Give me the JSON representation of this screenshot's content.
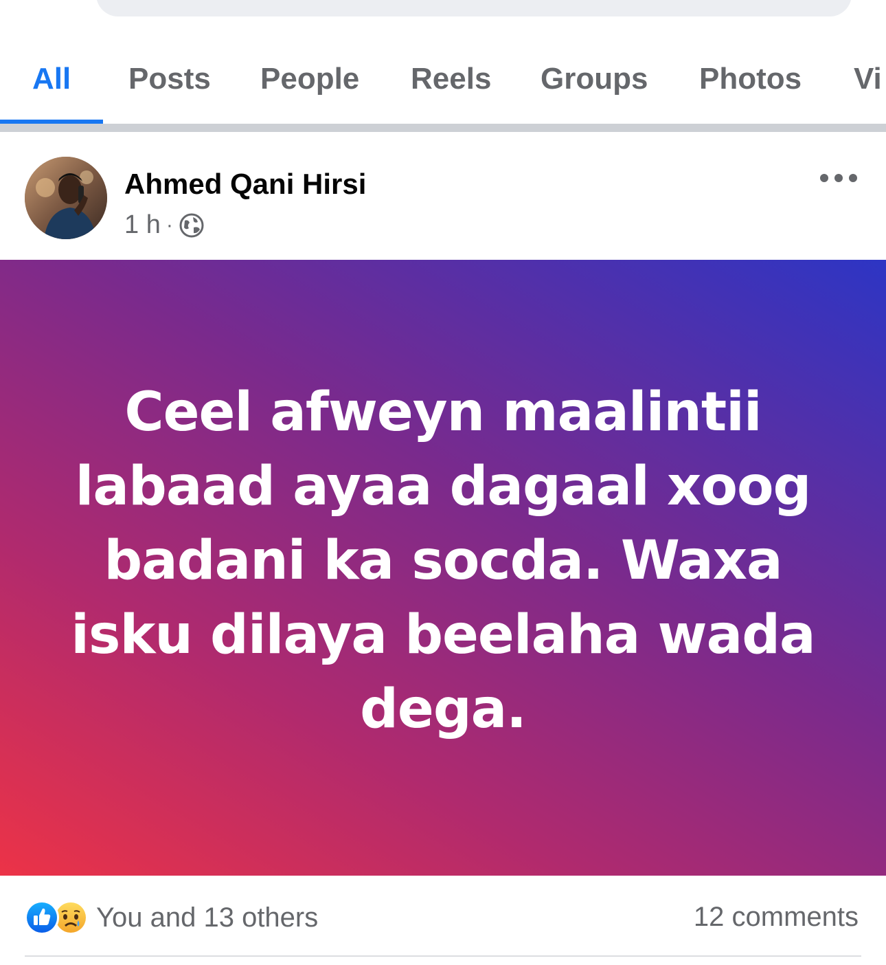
{
  "tabs": [
    {
      "label": "All",
      "active": true
    },
    {
      "label": "Posts"
    },
    {
      "label": "People"
    },
    {
      "label": "Reels"
    },
    {
      "label": "Groups"
    },
    {
      "label": "Photos"
    },
    {
      "label": "Vi"
    }
  ],
  "post": {
    "author": "Ahmed Qani Hirsi",
    "time": "1 h",
    "separator": "·",
    "privacy_icon": "globe-icon",
    "text": "Ceel afweyn maalintii labaad ayaa dagaal xoog badani ka socda. Waxa isku dilaya beelaha wada dega.",
    "background_colors": [
      "#ec3347",
      "#b02a6e",
      "#7b2a8c",
      "#2d35c4"
    ],
    "reactions_text": "You and 13 others",
    "reaction_icons": [
      "like-icon",
      "sad-icon"
    ],
    "comments_text": "12 comments"
  },
  "colors": {
    "accent": "#1877f2",
    "secondary_text": "#65676b"
  }
}
